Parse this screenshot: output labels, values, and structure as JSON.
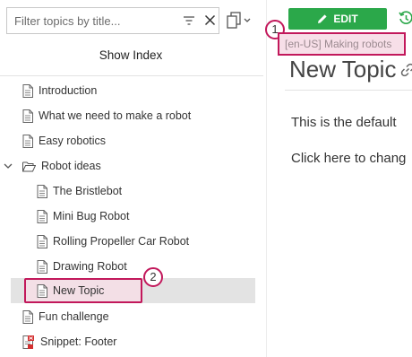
{
  "search": {
    "placeholder": "Filter topics by title..."
  },
  "left_panel": {
    "show_index_label": "Show Index"
  },
  "tree": {
    "items": [
      {
        "label": "Introduction",
        "icon": "document-icon"
      },
      {
        "label": "What we need to make a robot",
        "icon": "document-icon"
      },
      {
        "label": "Easy robotics",
        "icon": "document-icon"
      },
      {
        "label": "Robot ideas",
        "icon": "folder-open-icon",
        "expanded": true
      },
      {
        "label": "The Bristlebot",
        "icon": "document-icon"
      },
      {
        "label": "Mini Bug Robot",
        "icon": "document-icon"
      },
      {
        "label": "Rolling Propeller Car Robot",
        "icon": "document-icon"
      },
      {
        "label": "Drawing Robot",
        "icon": "document-icon"
      },
      {
        "label": "New Topic",
        "icon": "document-icon",
        "selected": true
      },
      {
        "label": "Fun challenge",
        "icon": "document-icon"
      },
      {
        "label": "Snippet: Footer",
        "icon": "snippet-icon"
      }
    ]
  },
  "badges": {
    "one": "1",
    "two": "2"
  },
  "toolbar": {
    "edit_label": "EDIT"
  },
  "topic": {
    "breadcrumb": "[en-US] Making robots",
    "title": "New Topic",
    "body_line_1": "This is the default",
    "body_line_2": "Click here to chang"
  },
  "colors": {
    "accent_green": "#2ba84a",
    "highlight": "#c2185b"
  }
}
